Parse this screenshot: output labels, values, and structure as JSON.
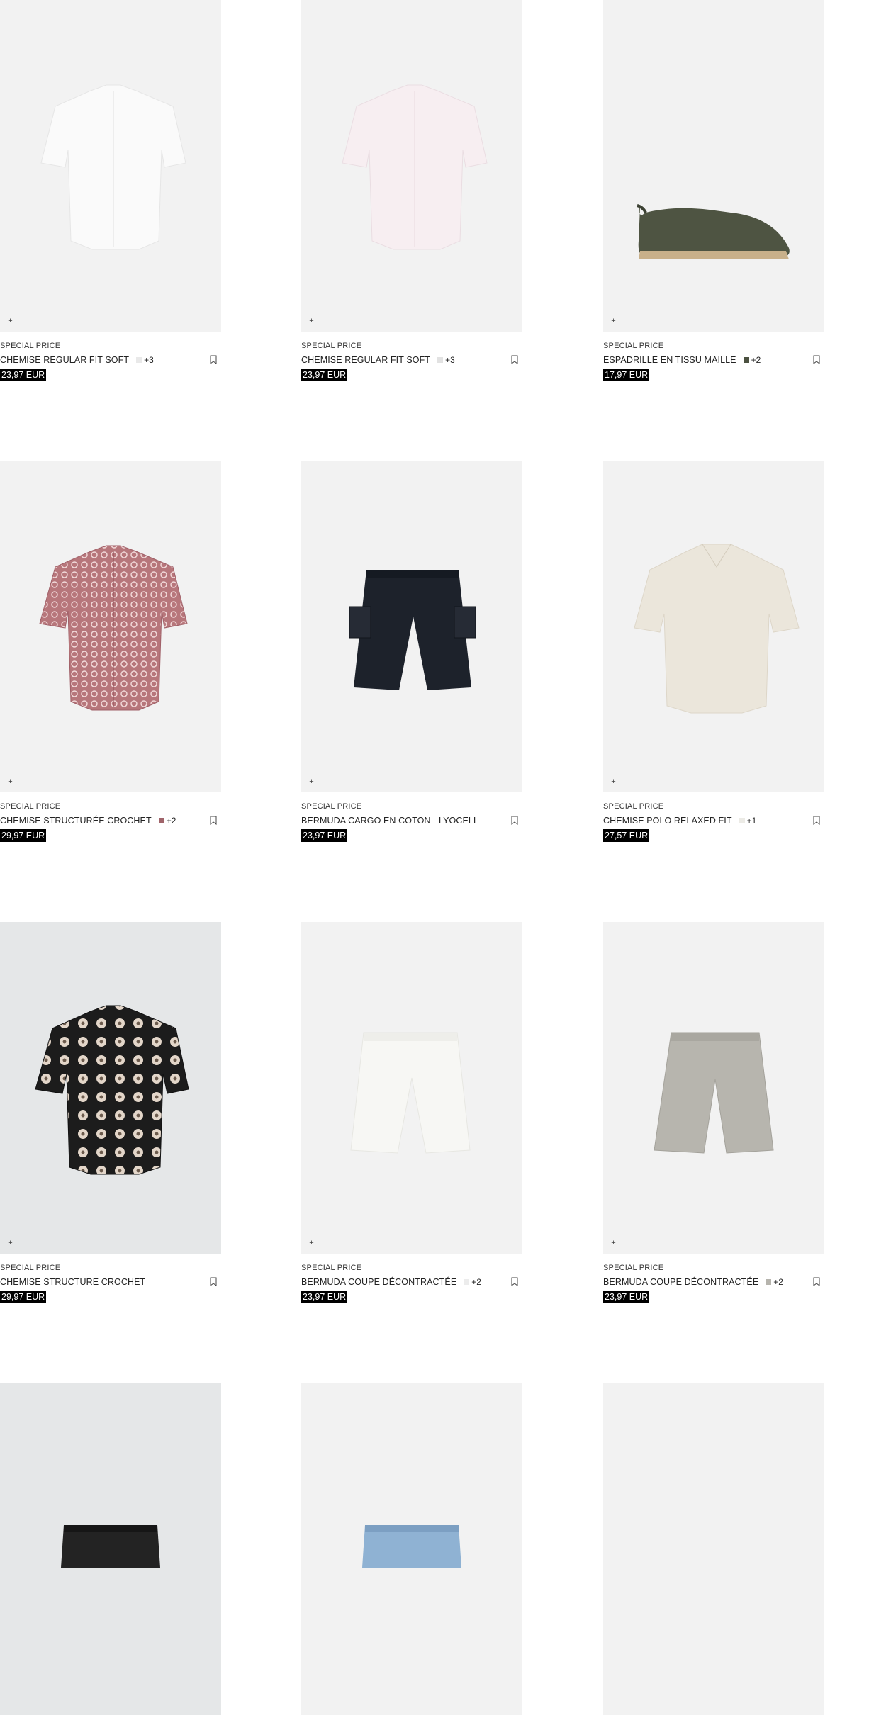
{
  "products": [
    {
      "label": "SPECIAL PRICE",
      "name": "CHEMISE REGULAR FIT SOFT",
      "swatch": "#e9e9e9",
      "more": "+3",
      "price": "23,97 EUR",
      "bg": "#f2f2f2",
      "icon": "white-shirt"
    },
    {
      "label": "SPECIAL PRICE",
      "name": "CHEMISE REGULAR FIT SOFT",
      "swatch": "#e2e2e2",
      "more": "+3",
      "price": "23,97 EUR",
      "bg": "#f2f2f2",
      "icon": "pink-shirt"
    },
    {
      "label": "SPECIAL PRICE",
      "name": "ESPADRILLE EN TISSU MAILLE",
      "swatch": "#4b5140",
      "more": "+2",
      "price": "17,97 EUR",
      "bg": "#f2f2f2",
      "icon": "espadrille"
    },
    {
      "label": "SPECIAL PRICE",
      "name": "CHEMISE STRUCTURÉE CROCHET",
      "swatch": "#a0646a",
      "more": "+2",
      "price": "29,97 EUR",
      "bg": "#f2f2f2",
      "icon": "crochet-shirt-red"
    },
    {
      "label": "SPECIAL PRICE",
      "name": "BERMUDA CARGO EN COTON - LYOCELL",
      "swatch": "",
      "more": "",
      "price": "23,97 EUR",
      "bg": "#f2f2f2",
      "icon": "cargo-shorts"
    },
    {
      "label": "SPECIAL PRICE",
      "name": "CHEMISE POLO RELAXED FIT",
      "swatch": "#ecebe6",
      "more": "+1",
      "price": "27,57 EUR",
      "bg": "#f2f2f2",
      "icon": "polo-shirt"
    },
    {
      "label": "SPECIAL PRICE",
      "name": "CHEMISE STRUCTURE CROCHET",
      "swatch": "",
      "more": "",
      "price": "29,97 EUR",
      "bg": "#e5e7e8",
      "icon": "crochet-shirt-black"
    },
    {
      "label": "SPECIAL PRICE",
      "name": "BERMUDA COUPE DÉCONTRACTÉE",
      "swatch": "#ececec",
      "more": "+2",
      "price": "23,97 EUR",
      "bg": "#f2f2f2",
      "icon": "white-shorts"
    },
    {
      "label": "SPECIAL PRICE",
      "name": "BERMUDA COUPE DÉCONTRACTÉE",
      "swatch": "#b6b4ad",
      "more": "+2",
      "price": "23,97 EUR",
      "bg": "#f2f2f2",
      "icon": "grey-shorts"
    },
    {
      "label": "",
      "name": "",
      "swatch": "",
      "more": "",
      "price": "",
      "bg": "#e5e7e8",
      "icon": "black-jeans"
    },
    {
      "label": "",
      "name": "",
      "swatch": "",
      "more": "",
      "price": "",
      "bg": "#f2f2f2",
      "icon": "blue-jeans"
    },
    {
      "label": "",
      "name": "",
      "swatch": "",
      "more": "",
      "price": "",
      "bg": "#f2f2f2",
      "icon": ""
    }
  ],
  "icons": {
    "add": "plus-icon",
    "save": "bookmark-icon"
  }
}
